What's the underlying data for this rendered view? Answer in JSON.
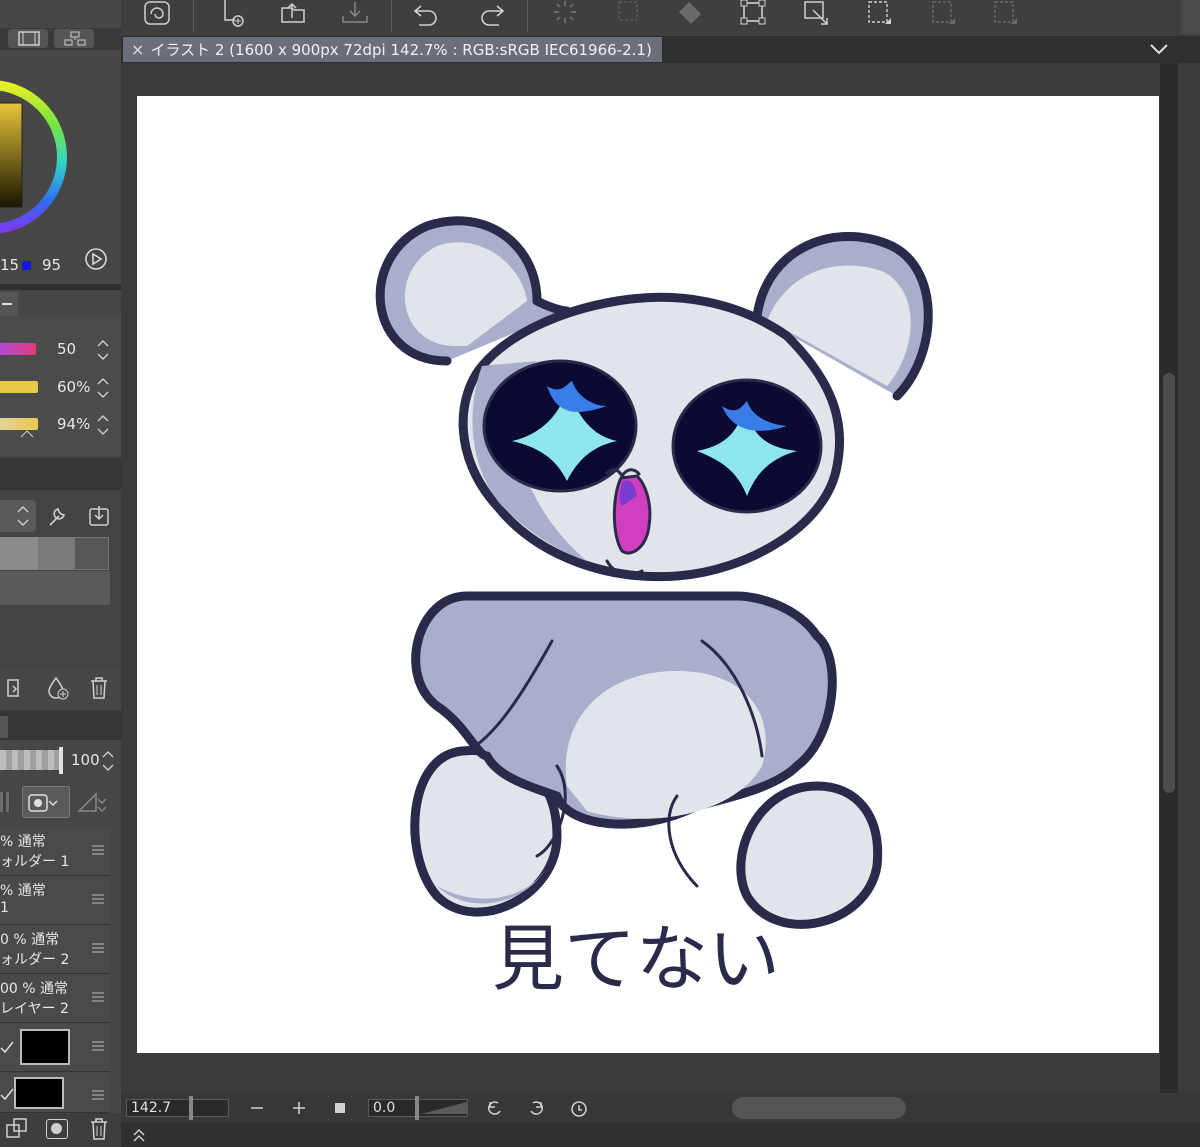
{
  "document_tab": {
    "close_glyph": "×",
    "title": "イラスト 2 (1600 x 900px 72dpi 142.7% : RGB:sRGB IEC61966-2.1)"
  },
  "color_panel": {
    "value_a": "15",
    "value_b": "95"
  },
  "sliders": [
    {
      "value": "50",
      "color": "#d63ad1"
    },
    {
      "value": "60%",
      "color": "#e8c94a"
    },
    {
      "value": "94%",
      "color": "#e8c94a"
    }
  ],
  "layer_panel": {
    "opacity_value": "100",
    "layers": [
      {
        "line1": "% 通常",
        "line2": "ォルダー 1"
      },
      {
        "line1": "% 通常",
        "line2": "1"
      },
      {
        "line1": "0 % 通常",
        "line2": "ォルダー 2"
      },
      {
        "line1": "00 % 通常",
        "line2": "レイヤー 2"
      }
    ]
  },
  "bottom_bar": {
    "zoom_value": "142.7",
    "rotation_value": "0.0"
  },
  "artwork": {
    "caption": "見てない"
  },
  "colors": {
    "panel_bg": "#474747",
    "canvas_bg": "#ffffff",
    "tab_active": "#6a6f7a",
    "outline": "#2a2a4a",
    "body_light": "#e1e4ea",
    "body_shadow": "#a9aecb",
    "eye_dark": "#0b0a33",
    "eye_blue": "#3a7ce8",
    "eye_cyan": "#8ee6ea",
    "mouth": "#cf3fbf"
  }
}
